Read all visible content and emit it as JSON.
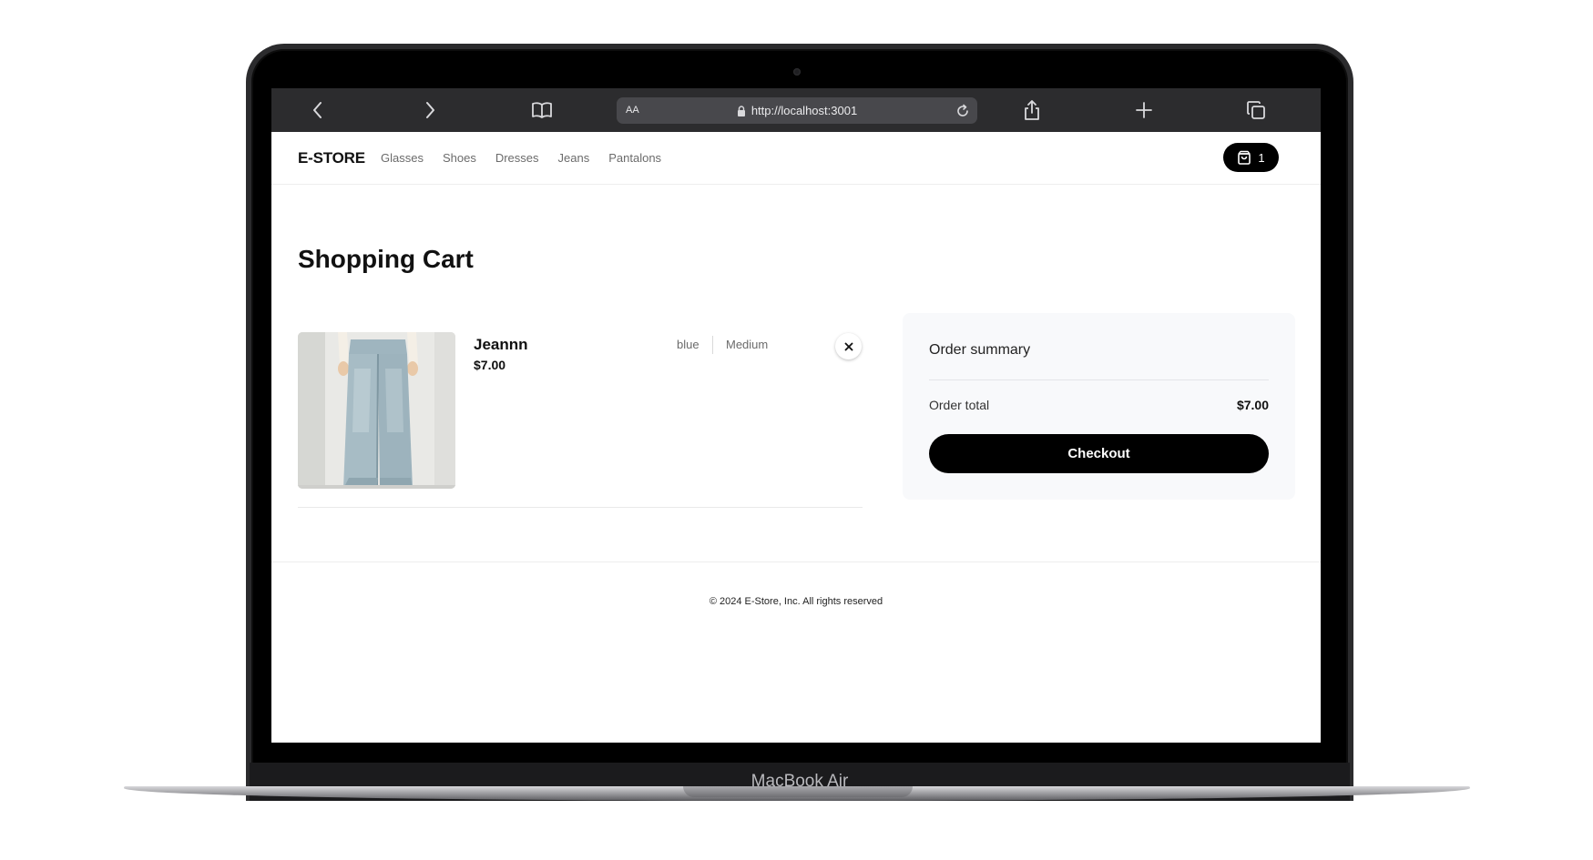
{
  "device": {
    "label": "MacBook Air"
  },
  "browser": {
    "address_prefix": "AA",
    "url": "http://localhost:3001",
    "icons": [
      "back-icon",
      "forward-icon",
      "bookmarks-icon",
      "lock-icon",
      "reload-icon",
      "share-icon",
      "new-tab-icon",
      "tabs-icon"
    ]
  },
  "header": {
    "logo": "E-STORE",
    "nav": [
      "Glasses",
      "Shoes",
      "Dresses",
      "Jeans",
      "Pantalons"
    ],
    "cart_count": "1",
    "cart_icon": "shopping-bag-icon"
  },
  "main": {
    "title": "Shopping Cart",
    "items": [
      {
        "name": "Jeannn",
        "price": "$7.00",
        "color": "blue",
        "size": "Medium",
        "remove_icon": "close-icon"
      }
    ]
  },
  "summary": {
    "title": "Order summary",
    "total_label": "Order total",
    "total_value": "$7.00",
    "checkout_label": "Checkout"
  },
  "footer": {
    "copyright": "© 2024 E-Store, Inc. All rights reserved"
  },
  "colors": {
    "accent": "#000000",
    "toolbar": "#2c2c2e",
    "summary_bg": "#f8f9fb"
  }
}
